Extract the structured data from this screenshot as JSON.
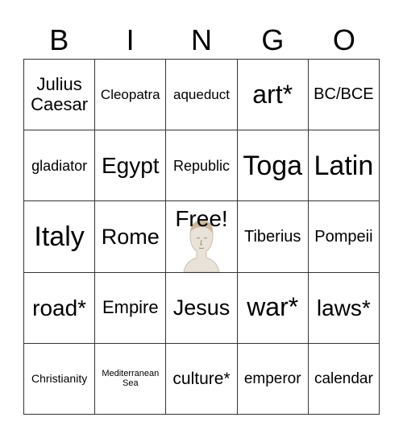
{
  "header": [
    "B",
    "I",
    "N",
    "G",
    "O"
  ],
  "cells": [
    {
      "text": "Julius Caesar",
      "size": 22
    },
    {
      "text": "Cleopatra",
      "size": 17
    },
    {
      "text": "aqueduct",
      "size": 17
    },
    {
      "text": "art*",
      "size": 32
    },
    {
      "text": "BC/BCE",
      "size": 20
    },
    {
      "text": "gladiator",
      "size": 18
    },
    {
      "text": "Egypt",
      "size": 28
    },
    {
      "text": "Republic",
      "size": 18
    },
    {
      "text": "Toga",
      "size": 34
    },
    {
      "text": "Latin",
      "size": 34
    },
    {
      "text": "Italy",
      "size": 34
    },
    {
      "text": "Rome",
      "size": 27
    },
    {
      "text": "Free!",
      "size": 28,
      "free": true,
      "icon": "roman-bust-icon"
    },
    {
      "text": "Tiberius",
      "size": 20
    },
    {
      "text": "Pompeii",
      "size": 20
    },
    {
      "text": "road*",
      "size": 28
    },
    {
      "text": "Empire",
      "size": 22
    },
    {
      "text": "Jesus",
      "size": 27
    },
    {
      "text": "war*",
      "size": 32
    },
    {
      "text": "laws*",
      "size": 28
    },
    {
      "text": "Christianity",
      "size": 14
    },
    {
      "text": "Mediterranean Sea",
      "size": 11
    },
    {
      "text": "culture*",
      "size": 21
    },
    {
      "text": "emperor",
      "size": 19
    },
    {
      "text": "calendar",
      "size": 19
    }
  ]
}
